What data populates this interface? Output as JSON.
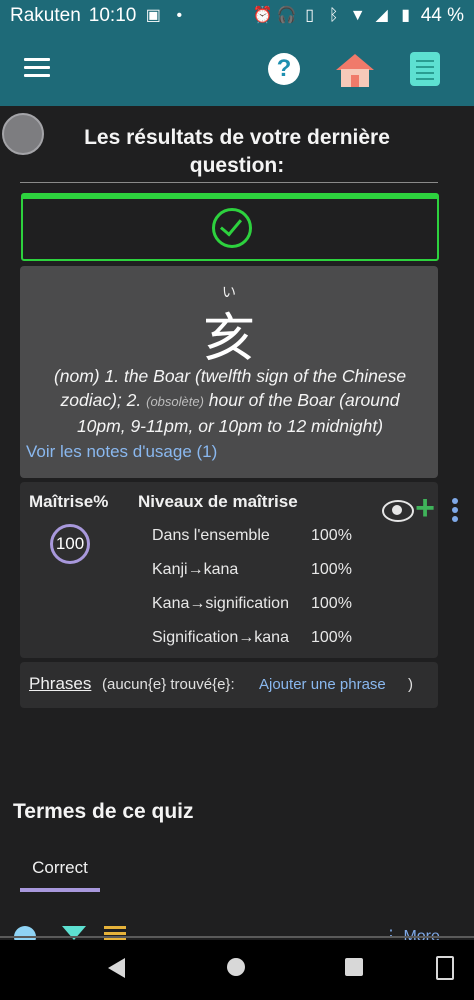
{
  "status_bar": {
    "carrier": "Rakuten",
    "time": "10:10",
    "battery": "44 %"
  },
  "app_bar": {
    "menu_icon": "hamburger-menu-icon",
    "help_icon": "help-icon",
    "home_icon": "home-icon",
    "book_icon": "book-icon"
  },
  "result": {
    "title": "Les résultats de votre dernière question:",
    "status": "correct",
    "check_icon": "check-circle-icon"
  },
  "card": {
    "reading": "い",
    "kanji": "亥",
    "pos": "(nom)",
    "meaning_part1": " 1. the Boar (twelfth sign of the Chinese zodiac); 2. ",
    "tag": "(obsolète)",
    "meaning_part2": " hour of the Boar (around 10pm, 9-11pm, or 10pm to 12 midnight)",
    "usage_link": "Voir les notes d'usage (1)"
  },
  "mastery": {
    "label": "Maîtrise%",
    "score": "100",
    "levels_title": "Niveaux de maîtrise",
    "levels": [
      {
        "name": "Dans l'ensemble",
        "value": "100%"
      },
      {
        "name": "Kanji→kana",
        "value": "100%"
      },
      {
        "name": "Kana→signification",
        "value": "100%"
      },
      {
        "name": "Signification→kana",
        "value": "100%"
      }
    ]
  },
  "phrases": {
    "label": "Phrases",
    "none_found": "(aucun{e} trouvé{e}:",
    "add_link": "Ajouter une phrase",
    "close_paren": ")"
  },
  "quiz_terms": {
    "title": "Termes de ce quiz",
    "tab": "Correct",
    "more": "More"
  },
  "colors": {
    "accent_teal": "#1e6a78",
    "success_green": "#2dd23e",
    "link_blue": "#8ab8ef",
    "ring_purple": "#a898dc"
  }
}
